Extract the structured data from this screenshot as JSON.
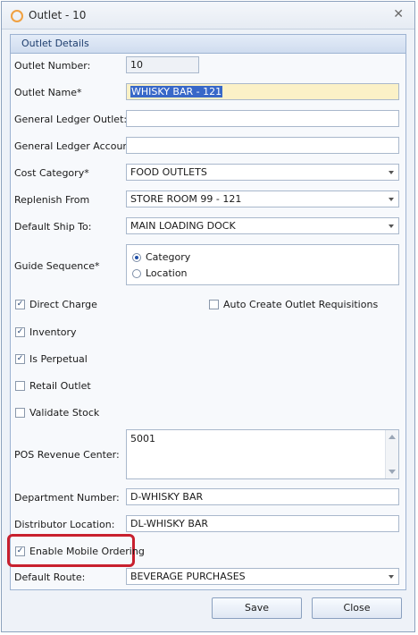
{
  "window": {
    "title": "Outlet - 10"
  },
  "group": {
    "header": "Outlet Details"
  },
  "fields": {
    "outlet_number": {
      "label": "Outlet Number:",
      "value": "10"
    },
    "outlet_name": {
      "label": "Outlet Name*",
      "value": "WHISKY BAR - 121"
    },
    "gl_outlet": {
      "label": "General Ledger Outlet:",
      "value": ""
    },
    "gl_account": {
      "label": "General Ledger Account:",
      "value": ""
    },
    "cost_category": {
      "label": "Cost Category*",
      "value": "FOOD OUTLETS"
    },
    "replenish_from": {
      "label": "Replenish From",
      "value": "STORE ROOM 99 - 121"
    },
    "default_ship_to": {
      "label": "Default Ship To:",
      "value": "MAIN LOADING DOCK"
    },
    "guide_sequence": {
      "label": "Guide Sequence*",
      "options": [
        "Category",
        "Location"
      ],
      "selected": "Category"
    },
    "pos_revenue_center": {
      "label": "POS Revenue Center:",
      "value": "5001"
    },
    "department_number": {
      "label": "Department Number:",
      "value": "D-WHISKY BAR"
    },
    "distributor_location": {
      "label": "Distributor Location:",
      "value": "DL-WHISKY BAR"
    },
    "default_route": {
      "label": "Default Route:",
      "value": "BEVERAGE PURCHASES"
    }
  },
  "checkboxes": {
    "direct_charge": {
      "label": "Direct Charge",
      "checked": true,
      "mark": "✓"
    },
    "auto_create": {
      "label": "Auto Create Outlet Requisitions",
      "checked": false,
      "mark": ""
    },
    "inventory": {
      "label": "Inventory",
      "checked": true,
      "mark": "✓"
    },
    "is_perpetual": {
      "label": "Is Perpetual",
      "checked": true,
      "mark": "✓"
    },
    "retail_outlet": {
      "label": "Retail Outlet",
      "checked": false,
      "mark": ""
    },
    "validate_stock": {
      "label": "Validate Stock",
      "checked": false,
      "mark": ""
    },
    "enable_mobile": {
      "label": "Enable Mobile Ordering",
      "checked": true,
      "mark": "✓"
    }
  },
  "buttons": {
    "save": "Save",
    "close": "Close"
  },
  "icons": {
    "app": "circle-app-icon",
    "close": "close-icon",
    "dropdown": "chevron-down-icon"
  },
  "colors": {
    "highlight": "#c8202e",
    "selection": "#3868c8",
    "required_field_bg": "#fbf1c7"
  }
}
